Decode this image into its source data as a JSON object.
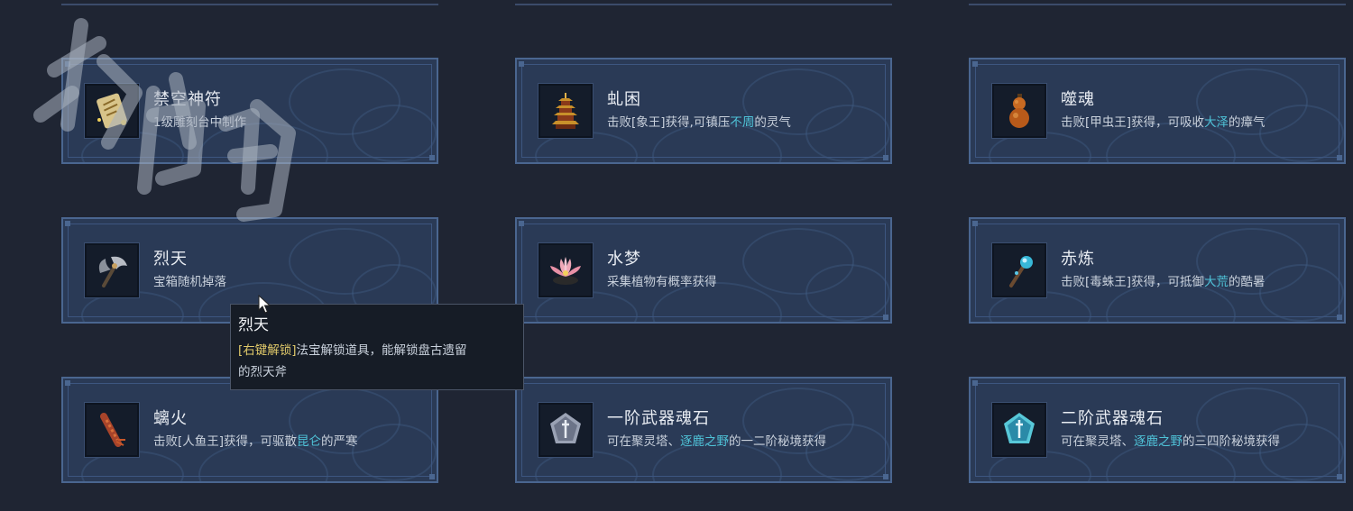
{
  "colors": {
    "background": "#1f2533",
    "card": "#2a3a56",
    "card_border": "#4a6690",
    "highlight": "#4fc3d8",
    "tooltip_key": "#e0c96a"
  },
  "items": [
    {
      "name": "禁空神符",
      "icon": "talisman-scroll-icon",
      "desc": [
        {
          "t": "1级雕刻台中制作"
        }
      ]
    },
    {
      "name": "虬困",
      "icon": "pagoda-icon",
      "desc": [
        {
          "t": "击败[象王]获得,可镇压"
        },
        {
          "t": "不周",
          "hl": true
        },
        {
          "t": "的灵气"
        }
      ]
    },
    {
      "name": "噬魂",
      "icon": "gourd-icon",
      "desc": [
        {
          "t": "击败[甲虫王]获得，可吸收"
        },
        {
          "t": "大泽",
          "hl": true
        },
        {
          "t": "的瘴气"
        }
      ]
    },
    {
      "name": "烈天",
      "icon": "axe-icon",
      "desc": [
        {
          "t": "宝箱随机掉落"
        }
      ]
    },
    {
      "name": "水梦",
      "icon": "lotus-icon",
      "desc": [
        {
          "t": "采集植物有概率获得"
        }
      ]
    },
    {
      "name": "赤炼",
      "icon": "orb-staff-icon",
      "desc": [
        {
          "t": "击败[毒蛛王]获得，可抵御"
        },
        {
          "t": "大荒",
          "hl": true
        },
        {
          "t": "的酷暑"
        }
      ]
    },
    {
      "name": "螭火",
      "icon": "fire-claw-icon",
      "desc": [
        {
          "t": "击败[人鱼王]获得，可驱散"
        },
        {
          "t": "昆仑",
          "hl": true
        },
        {
          "t": "的严寒"
        }
      ]
    },
    {
      "name": "一阶武器魂石",
      "icon": "silver-soulstone-icon",
      "desc": [
        {
          "t": "可在聚灵塔、"
        },
        {
          "t": "逐鹿之野",
          "hl": true
        },
        {
          "t": "的一二阶秘境获得"
        }
      ]
    },
    {
      "name": "二阶武器魂石",
      "icon": "blue-soulstone-icon",
      "desc": [
        {
          "t": "可在聚灵塔、"
        },
        {
          "t": "逐鹿之野",
          "hl": true
        },
        {
          "t": "的三四阶秘境获得"
        }
      ]
    }
  ],
  "tooltip": {
    "title": "烈天",
    "key_label": "[右键解锁]",
    "body_line1": "法宝解锁道具，能解锁盘古遗留",
    "body_line2": "的烈天斧"
  }
}
